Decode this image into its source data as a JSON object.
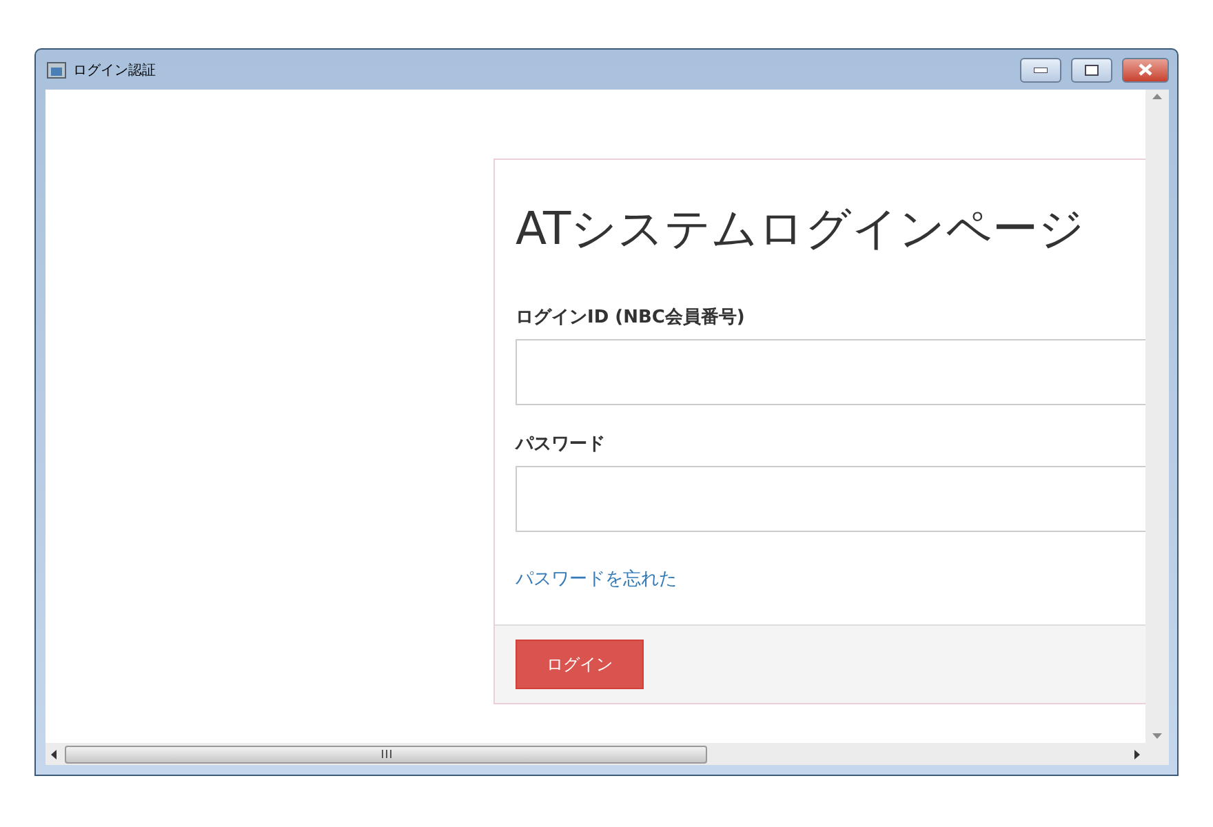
{
  "window": {
    "title": "ログイン認証"
  },
  "page": {
    "heading": "ATシステムログインページ",
    "fields": [
      {
        "label": "ログインID (NBC会員番号)"
      },
      {
        "label": "パスワード"
      }
    ],
    "forgot_link": "パスワードを忘れた",
    "submit_button": "ログイン"
  }
}
